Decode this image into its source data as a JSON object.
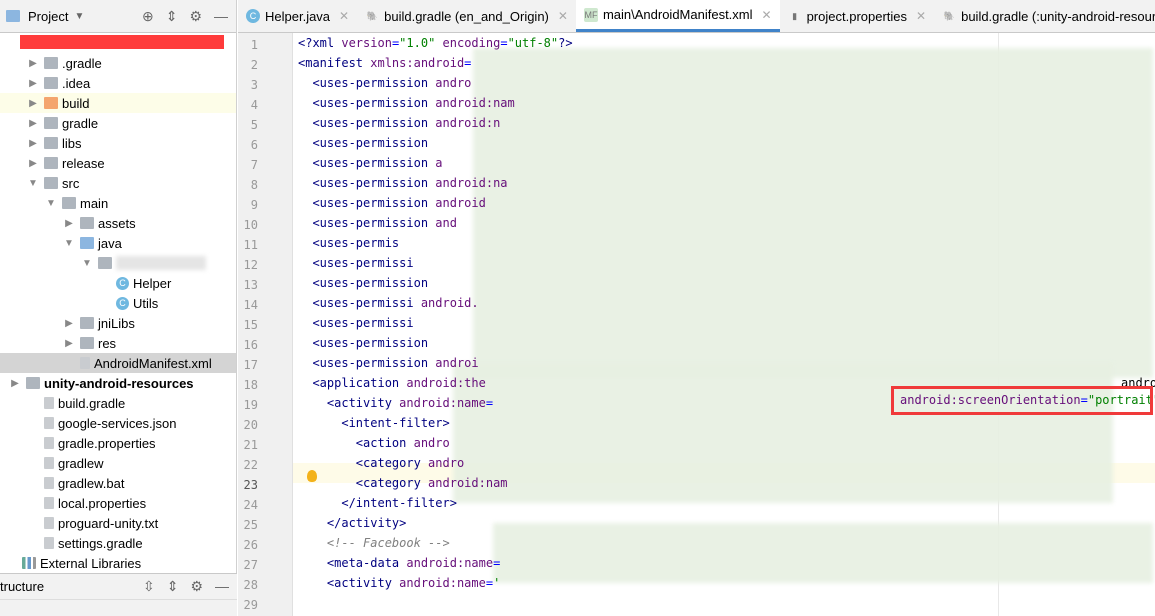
{
  "sidebar": {
    "title": "Project",
    "icons": [
      "target-icon",
      "collapse-icon",
      "gear-icon",
      "minimize-icon"
    ],
    "items": [
      {
        "label": ".gradle",
        "depth": 0,
        "type": "folder",
        "arrow": "▶"
      },
      {
        "label": ".idea",
        "depth": 0,
        "type": "folder",
        "arrow": "▶"
      },
      {
        "label": "build",
        "depth": 0,
        "type": "folder-orange",
        "arrow": "▶"
      },
      {
        "label": "gradle",
        "depth": 0,
        "type": "folder",
        "arrow": "▶"
      },
      {
        "label": "libs",
        "depth": 0,
        "type": "folder",
        "arrow": "▶"
      },
      {
        "label": "release",
        "depth": 0,
        "type": "folder",
        "arrow": "▶"
      },
      {
        "label": "src",
        "depth": 0,
        "type": "folder",
        "arrow": "▼"
      },
      {
        "label": "main",
        "depth": 1,
        "type": "folder",
        "arrow": "▼"
      },
      {
        "label": "assets",
        "depth": 2,
        "type": "folder",
        "arrow": "▶"
      },
      {
        "label": "java",
        "depth": 2,
        "type": "folder-blue",
        "arrow": "▼"
      },
      {
        "label": "",
        "depth": 3,
        "type": "folder",
        "arrow": "▼"
      },
      {
        "label": "Helper",
        "depth": 4,
        "type": "class",
        "arrow": ""
      },
      {
        "label": "Utils",
        "depth": 4,
        "type": "class",
        "arrow": ""
      },
      {
        "label": "jniLibs",
        "depth": 2,
        "type": "folder",
        "arrow": "▶"
      },
      {
        "label": "res",
        "depth": 2,
        "type": "folder",
        "arrow": "▶"
      },
      {
        "label": "AndroidManifest.xml",
        "depth": 2,
        "type": "file",
        "arrow": "",
        "selected": true
      },
      {
        "label": "unity-android-resources",
        "depth": -1,
        "type": "folder",
        "arrow": "▶",
        "bold": true
      },
      {
        "label": "build.gradle",
        "depth": 0,
        "type": "file",
        "arrow": ""
      },
      {
        "label": "google-services.json",
        "depth": 0,
        "type": "file",
        "arrow": ""
      },
      {
        "label": "gradle.properties",
        "depth": 0,
        "type": "file",
        "arrow": ""
      },
      {
        "label": "gradlew",
        "depth": 0,
        "type": "file",
        "arrow": ""
      },
      {
        "label": "gradlew.bat",
        "depth": 0,
        "type": "file",
        "arrow": ""
      },
      {
        "label": "local.properties",
        "depth": 0,
        "type": "file",
        "arrow": ""
      },
      {
        "label": "proguard-unity.txt",
        "depth": 0,
        "type": "file",
        "arrow": ""
      },
      {
        "label": "settings.gradle",
        "depth": 0,
        "type": "file",
        "arrow": ""
      },
      {
        "label": "External Libraries",
        "depth": -2,
        "type": "libs",
        "arrow": ""
      }
    ]
  },
  "structure": {
    "title": "tructure"
  },
  "tabs": [
    {
      "label": "Helper.java",
      "icon": "class-icon"
    },
    {
      "label": "build.gradle (en_and_Origin)",
      "icon": "gradle-icon"
    },
    {
      "label": "main\\AndroidManifest.xml",
      "icon": "manifest-icon",
      "active": true
    },
    {
      "label": "project.properties",
      "icon": "properties-icon"
    },
    {
      "label": "build.gradle (:unity-android-resources)",
      "icon": "gradle-icon"
    }
  ],
  "editor": {
    "current_line": 23,
    "highlight": "android:screenOrientation=\"portrait\"",
    "line18_tail": "andro",
    "lines": [
      [
        0,
        [
          [
            "tag",
            "<?xml "
          ],
          [
            "attr",
            "version"
          ],
          [
            "eq",
            "="
          ],
          [
            "str",
            "\"1.0\""
          ],
          [
            "attr",
            " encoding"
          ],
          [
            "eq",
            "="
          ],
          [
            "str",
            "\"utf-8\""
          ],
          [
            "tag",
            "?>"
          ]
        ]
      ],
      [
        0,
        [
          [
            "tag",
            "<manifest "
          ],
          [
            "attr",
            "xmlns:android"
          ],
          [
            "eq",
            "="
          ]
        ]
      ],
      [
        2,
        [
          [
            "tag",
            "<uses-permission "
          ],
          [
            "attr",
            "andro"
          ]
        ]
      ],
      [
        2,
        [
          [
            "tag",
            "<uses-permission "
          ],
          [
            "attr",
            "android:nam"
          ]
        ]
      ],
      [
        2,
        [
          [
            "tag",
            "<uses-permission "
          ],
          [
            "attr",
            "android:n"
          ]
        ]
      ],
      [
        2,
        [
          [
            "tag",
            "<uses-permission"
          ]
        ]
      ],
      [
        2,
        [
          [
            "tag",
            "<uses-permission "
          ],
          [
            "attr",
            "a"
          ]
        ]
      ],
      [
        2,
        [
          [
            "tag",
            "<uses-permission "
          ],
          [
            "attr",
            "android:na"
          ]
        ]
      ],
      [
        2,
        [
          [
            "tag",
            "<uses-permission "
          ],
          [
            "attr",
            "android"
          ]
        ]
      ],
      [
        2,
        [
          [
            "tag",
            "<uses-permission "
          ],
          [
            "attr",
            "and"
          ]
        ]
      ],
      [
        2,
        [
          [
            "tag",
            "<uses-permis"
          ]
        ]
      ],
      [
        2,
        [
          [
            "tag",
            "<uses-permissi"
          ]
        ]
      ],
      [
        2,
        [
          [
            "tag",
            "<uses-permission"
          ]
        ]
      ],
      [
        2,
        [
          [
            "tag",
            "<uses-permissi "
          ],
          [
            "attr",
            "android."
          ]
        ]
      ],
      [
        2,
        [
          [
            "tag",
            "<uses-permissi"
          ]
        ]
      ],
      [
        2,
        [
          [
            "tag",
            "<uses-permission"
          ]
        ]
      ],
      [
        2,
        [
          [
            "tag",
            "<uses-permission "
          ],
          [
            "attr",
            "androi"
          ]
        ]
      ],
      [
        2,
        [
          [
            "tag",
            "<application "
          ],
          [
            "attr",
            "android:the"
          ]
        ]
      ],
      [
        4,
        [
          [
            "tag",
            "<activity "
          ],
          [
            "attr",
            "android:name"
          ],
          [
            "eq",
            "="
          ]
        ]
      ],
      [
        6,
        [
          [
            "tag",
            "<intent-filter>"
          ]
        ]
      ],
      [
        8,
        [
          [
            "tag",
            "<action "
          ],
          [
            "attr",
            "andro"
          ]
        ]
      ],
      [
        8,
        [
          [
            "tag",
            "<category "
          ],
          [
            "attr",
            "andro"
          ]
        ]
      ],
      [
        8,
        [
          [
            "tag",
            "<category "
          ],
          [
            "attr",
            "android:nam"
          ]
        ]
      ],
      [
        6,
        [
          [
            "tag",
            "</intent-filter>"
          ]
        ]
      ],
      [
        4,
        [
          [
            "tag",
            "</activity>"
          ]
        ]
      ],
      [
        4,
        [
          [
            "cm",
            "<!-- Facebook -->"
          ]
        ]
      ],
      [
        4,
        [
          [
            "tag",
            "<meta-data "
          ],
          [
            "attr",
            "android:name"
          ],
          [
            "eq",
            "="
          ]
        ]
      ],
      [
        4,
        [
          [
            "tag",
            "<activity "
          ],
          [
            "attr",
            "android:name"
          ],
          [
            "eq",
            "="
          ],
          [
            "str",
            "'"
          ]
        ]
      ],
      [
        0,
        []
      ]
    ]
  }
}
